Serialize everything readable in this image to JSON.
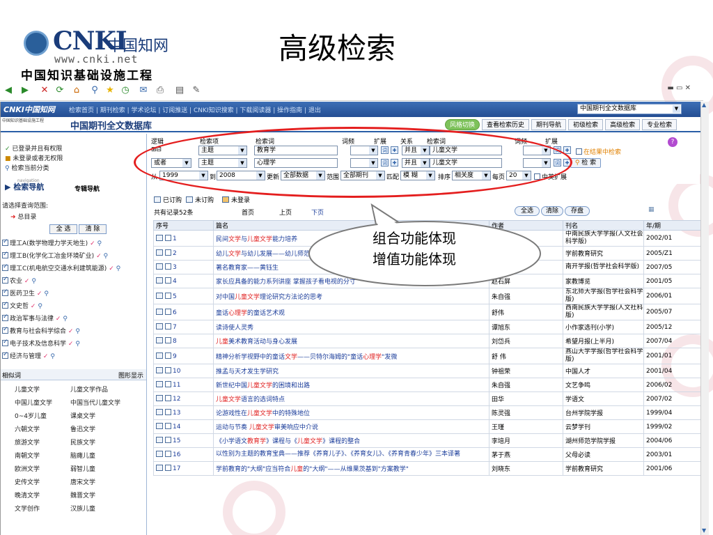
{
  "slide": {
    "title": "高级检索",
    "logo_brand": "CNKI",
    "logo_cn": "中国知网",
    "logo_url": "www.cnki.net",
    "logo_sub": "中国知识基础设施工程"
  },
  "nav": {
    "logo": "CNKI中国知网",
    "links": "检索首页 | 期刊检索 | 学术论坛 | 订阅推送 | CNKI知识搜索 | 下载阅读器 | 操作指南 | 退出",
    "db_select": "中国期刊全文数据库"
  },
  "sub": {
    "logo_small": "中国知识基础设施工程",
    "db_title": "中国期刊全文数据库",
    "tabs": [
      "风格切换",
      "查看检索历史",
      "期刊导航",
      "初级检索",
      "高级检索",
      "专业检索"
    ]
  },
  "sidebar": {
    "status": [
      "已登录并且有权限",
      "未登录或者无权限",
      "检索当前分类"
    ],
    "nav_search": "检索导航",
    "nav_special": "专辑导航",
    "navigation_small": "navigation",
    "range_label": "请选择查询范围:",
    "root": "总目录",
    "select_all": "全 选",
    "clear": "清 除",
    "categories": [
      "理工A(数学物理力学天地生)",
      "理工B(化学化工冶金环境矿业)",
      "理工C(机电航空交通水利建筑能源)",
      "农业",
      "医药卫生",
      "文史哲",
      "政治军事与法律",
      "教育与社会科学综合",
      "电子技术及信息科学",
      "经济与管理"
    ],
    "related_title": "相似词",
    "related_mode": "图形显示",
    "related_words": [
      [
        "儿童文学",
        "儿童文学作品"
      ],
      [
        "中国儿童文学",
        "中国当代儿童文学"
      ],
      [
        "0~4岁儿童",
        "课桌文学"
      ],
      [
        "六朝文学",
        "鲁迅文学"
      ],
      [
        "旅游文学",
        "民族文学"
      ],
      [
        "南朝文学",
        "脑瘫儿童"
      ],
      [
        "欧洲文学",
        "弱智儿童"
      ],
      [
        "史传文学",
        "唐宋文学"
      ],
      [
        "晚清文学",
        "魏晋文学"
      ],
      [
        "文学创作",
        "汉族儿童"
      ]
    ]
  },
  "search": {
    "h_logic": "逻辑",
    "h_item": "检索项",
    "h_word": "检索词",
    "h_freq": "词频",
    "h_ext": "扩展",
    "h_rel": "关系",
    "h_word2": "检索词",
    "h_freq2": "词频",
    "h_ext2": "扩展",
    "row1": {
      "item": "主题",
      "word": "教育学",
      "rel": "并且",
      "word2": "儿童文学"
    },
    "row2": {
      "logic": "或者",
      "item": "主题",
      "word": "心理学",
      "rel": "并且",
      "word2": "儿童文学"
    },
    "in_result": "在结果中检索",
    "search_btn": "检 索",
    "from_label": "从",
    "from": "1999",
    "to_label": "到",
    "to": "2008",
    "update_label": "更新",
    "update": "全部数据",
    "range_label": "范围",
    "range": "全部期刊",
    "match_label": "匹配",
    "match": "模 糊",
    "sort_label": "排序",
    "sort": "相关度",
    "per_label": "每页",
    "per": "20",
    "cn_en": "中英扩展"
  },
  "results": {
    "legend": [
      "已订购",
      "未订购",
      "未登录"
    ],
    "count": "共有记录52条",
    "pager": [
      "首页",
      "上页",
      "下页"
    ],
    "btn_all": "全选",
    "btn_clear": "清除",
    "btn_save": "存盘",
    "headers": [
      "序号",
      "篇名",
      "作者",
      "刊名",
      "年/期"
    ],
    "rows": [
      {
        "no": "1",
        "title": "民间文学与儿童文学能力培养",
        "author": "",
        "journal": "中南民族大学学报(人文社会科学版)",
        "year": "2002/01"
      },
      {
        "no": "2",
        "title": "幼儿文学与幼儿发展——幼儿师范学校",
        "author": "",
        "journal": "学前教育研究",
        "year": "2005/Z1"
      },
      {
        "no": "3",
        "title": "著名教育家——黄钰生",
        "author": "",
        "journal": "南开学报(哲学社会科学版)",
        "year": "2007/05"
      },
      {
        "no": "4",
        "title": "家长应具备的能力系列讲座 掌握孩子看电视的分寸",
        "author": "赵石屏",
        "journal": "家教博览",
        "year": "2001/05"
      },
      {
        "no": "5",
        "title": "对中国儿童文学理论研究方法论的思考",
        "author": "朱自强",
        "journal": "东北师大学报(哲学社会科学版)",
        "year": "2006/01"
      },
      {
        "no": "6",
        "title": "童话心理学的童话艺术观",
        "author": "舒伟",
        "journal": "西南民族大学学报(人文社科版)",
        "year": "2005/07"
      },
      {
        "no": "7",
        "title": "读诗使人灵秀",
        "author": "谭旭东",
        "journal": "小作家选刊(小学)",
        "year": "2005/12"
      },
      {
        "no": "8",
        "title": "儿童美术教育活动与身心发展",
        "author": "刘岱兵",
        "journal": "希望月报(上半月)",
        "year": "2007/04"
      },
      {
        "no": "9",
        "title": "精神分析学视野中的童话文学——贝特尔海姆的\"童话心理学\"发微",
        "author": "舒 伟",
        "journal": "燕山大学学报(哲学社会科学版)",
        "year": "2001/01"
      },
      {
        "no": "10",
        "title": "推孟与天才发生学研究",
        "author": "钟祖荣",
        "journal": "中国人才",
        "year": "2001/04"
      },
      {
        "no": "11",
        "title": "新世纪中国儿童文学的困境和出路",
        "author": "朱自强",
        "journal": "文艺争鸣",
        "year": "2006/02"
      },
      {
        "no": "12",
        "title": "儿童文学语言的选词特点",
        "author": "田华",
        "journal": "学语文",
        "year": "2007/02"
      },
      {
        "no": "13",
        "title": "论游戏性在儿童文学中的特殊地位",
        "author": "陈灵强",
        "journal": "台州学院学报",
        "year": "1999/04"
      },
      {
        "no": "14",
        "title": "运动与节奏 儿童文学审美响应中介说",
        "author": "王瑾",
        "journal": "云梦学刊",
        "year": "1999/02"
      },
      {
        "no": "15",
        "title": "《小学语文教育学》课程与《儿童文学》课程的整合",
        "author": "李培月",
        "journal": "湖州师范学院学报",
        "year": "2004/06"
      },
      {
        "no": "16",
        "title": "以性别为主题的教育宝典——推荐《养育儿子》、《养育女儿》、《养育青春少年》三本译著",
        "author": "茅于燕",
        "journal": "父母必读",
        "year": "2003/01"
      },
      {
        "no": "17",
        "title": "学前教育的\"大纲\"应当符合儿童的\"大纲\"——从维果茨基到\"方案教学\"",
        "author": "刘晓东",
        "journal": "学前教育研究",
        "year": "2001/06"
      }
    ]
  },
  "callout": {
    "line1": "组合功能体现",
    "line2": "增值功能体现"
  },
  "colors": {
    "accent": "#e41e1e",
    "nav_blue": "#2a5ea6",
    "link": "#1a3c9a"
  }
}
